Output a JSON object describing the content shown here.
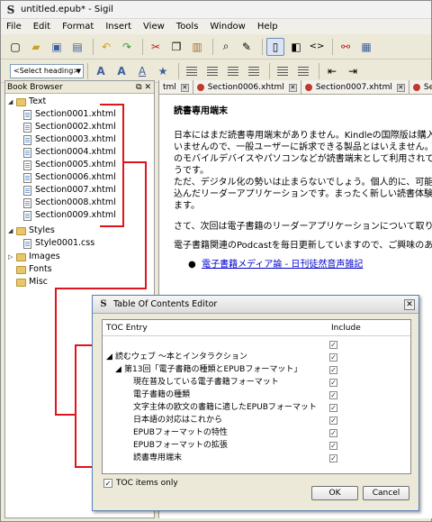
{
  "window": {
    "title": "untitled.epub* - Sigil",
    "app_icon": "S"
  },
  "menu": [
    "File",
    "Edit",
    "Format",
    "Insert",
    "View",
    "Tools",
    "Window",
    "Help"
  ],
  "toolbar": {
    "icons": [
      "new-file-icon",
      "open-folder-icon",
      "save-icon",
      "save-as-icon",
      "undo-icon",
      "redo-icon",
      "cut-icon",
      "copy-icon",
      "paste-icon",
      "find-icon",
      "spellcheck-icon",
      "book-view-icon",
      "split-view-icon",
      "code-view-icon",
      "link-icon",
      "image-icon"
    ]
  },
  "format_bar": {
    "heading_select": "<Select heading>"
  },
  "book_browser": {
    "title": "Book Browser",
    "text_folder": "Text",
    "files": [
      "Section0001.xhtml",
      "Section0002.xhtml",
      "Section0003.xhtml",
      "Section0004.xhtml",
      "Section0005.xhtml",
      "Section0006.xhtml",
      "Section0007.xhtml",
      "Section0008.xhtml",
      "Section0009.xhtml"
    ],
    "styles_folder": "Styles",
    "style_file": "Style0001.css",
    "images_folder": "Images",
    "fonts_folder": "Fonts",
    "misc_folder": "Misc"
  },
  "tabs": [
    {
      "label": "tml"
    },
    {
      "label": "Section0006.xhtml"
    },
    {
      "label": "Section0007.xhtml"
    },
    {
      "label": "Sectio"
    }
  ],
  "editor": {
    "heading": "読書専用端末",
    "para1_lines": [
      "日本にはまだ読書専用端末がありません。Kindleの国際版は購入",
      "いませんので、一般ユーザーに訴求できる製品とはいえません。現在",
      "のモバイルデバイスやパソコンなどが読書端末として利用されており",
      "うです。",
      "ただ、デジタル化の勢いは止まらないでしょう。個人的に、可能性を",
      "込んだリーダーアプリケーションです。まったく新しい読書体験を提供",
      "ます。"
    ],
    "para2": "さて、次回は電子書籍のリーダーアプリケーションについて取り上げて",
    "para3": "電子書籍関連のPodcastを毎日更新していますので、ご興味のあ",
    "link": "電子書籍メディア論 - 日刊徒然音声雑記"
  },
  "dialog": {
    "title": "Table Of Contents Editor",
    "col_entry": "TOC Entry",
    "col_include": "Include",
    "entries": [
      {
        "label": "読むウェブ 〜本とインタラクション",
        "level": 0,
        "checked": true
      },
      {
        "label": "第13回「電子書籍の種類とEPUBフォーマット」",
        "level": 1,
        "checked": true
      },
      {
        "label": "現在普及している電子書籍フォーマット",
        "level": 2,
        "checked": true
      },
      {
        "label": "電子書籍の種類",
        "level": 2,
        "checked": true
      },
      {
        "label": "文字主体の欧文の書籍に適したEPUBフォーマット",
        "level": 2,
        "checked": true
      },
      {
        "label": "日本語の対応はこれから",
        "level": 2,
        "checked": true
      },
      {
        "label": "EPUBフォーマットの特性",
        "level": 2,
        "checked": true
      },
      {
        "label": "EPUBフォーマットの拡張",
        "level": 2,
        "checked": true
      },
      {
        "label": "読書専用端末",
        "level": 2,
        "checked": true
      }
    ],
    "toc_only_label": "TOC items only",
    "toc_only_checked": true,
    "ok": "OK",
    "cancel": "Cancel"
  },
  "colors": {
    "annotation_red": "#e0141c",
    "link_blue": "#0000cc"
  }
}
